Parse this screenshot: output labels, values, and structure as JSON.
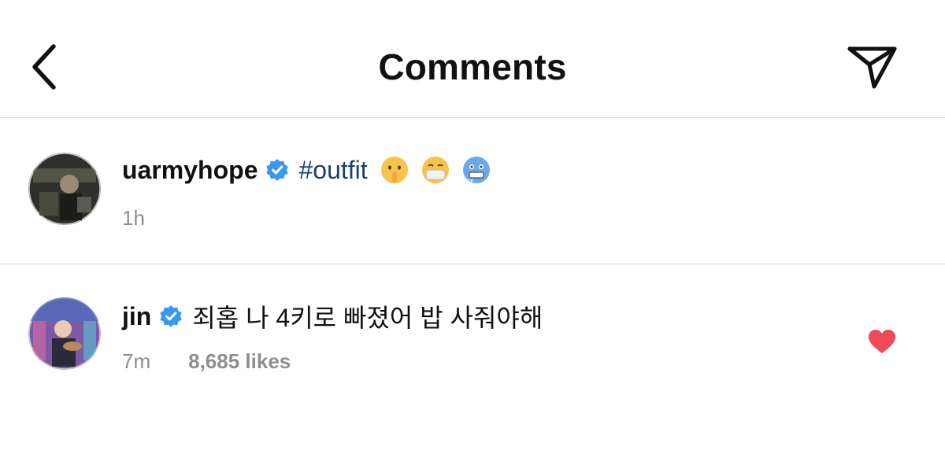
{
  "header": {
    "title": "Comments",
    "back_icon": "chevron-left-icon",
    "share_icon": "paper-plane-icon"
  },
  "comments": [
    {
      "username": "uarmyhope",
      "verified": true,
      "hashtag": "#outfit",
      "emojis": [
        "shushing-face-icon",
        "face-with-mask-icon",
        "cold-face-icon"
      ],
      "time": "1h"
    },
    {
      "username": "jin",
      "verified": true,
      "text": "죄홉 나 4키로 빠졌어 밥 사줘야해",
      "time": "7m",
      "likes": "8,685 likes",
      "liked": true
    }
  ],
  "colors": {
    "verified_blue": "#3897f0",
    "hashtag": "#1f3d74",
    "heart_red": "#ed4956",
    "meta_gray": "#8e8e8e",
    "divider": "#dcdcdc"
  }
}
